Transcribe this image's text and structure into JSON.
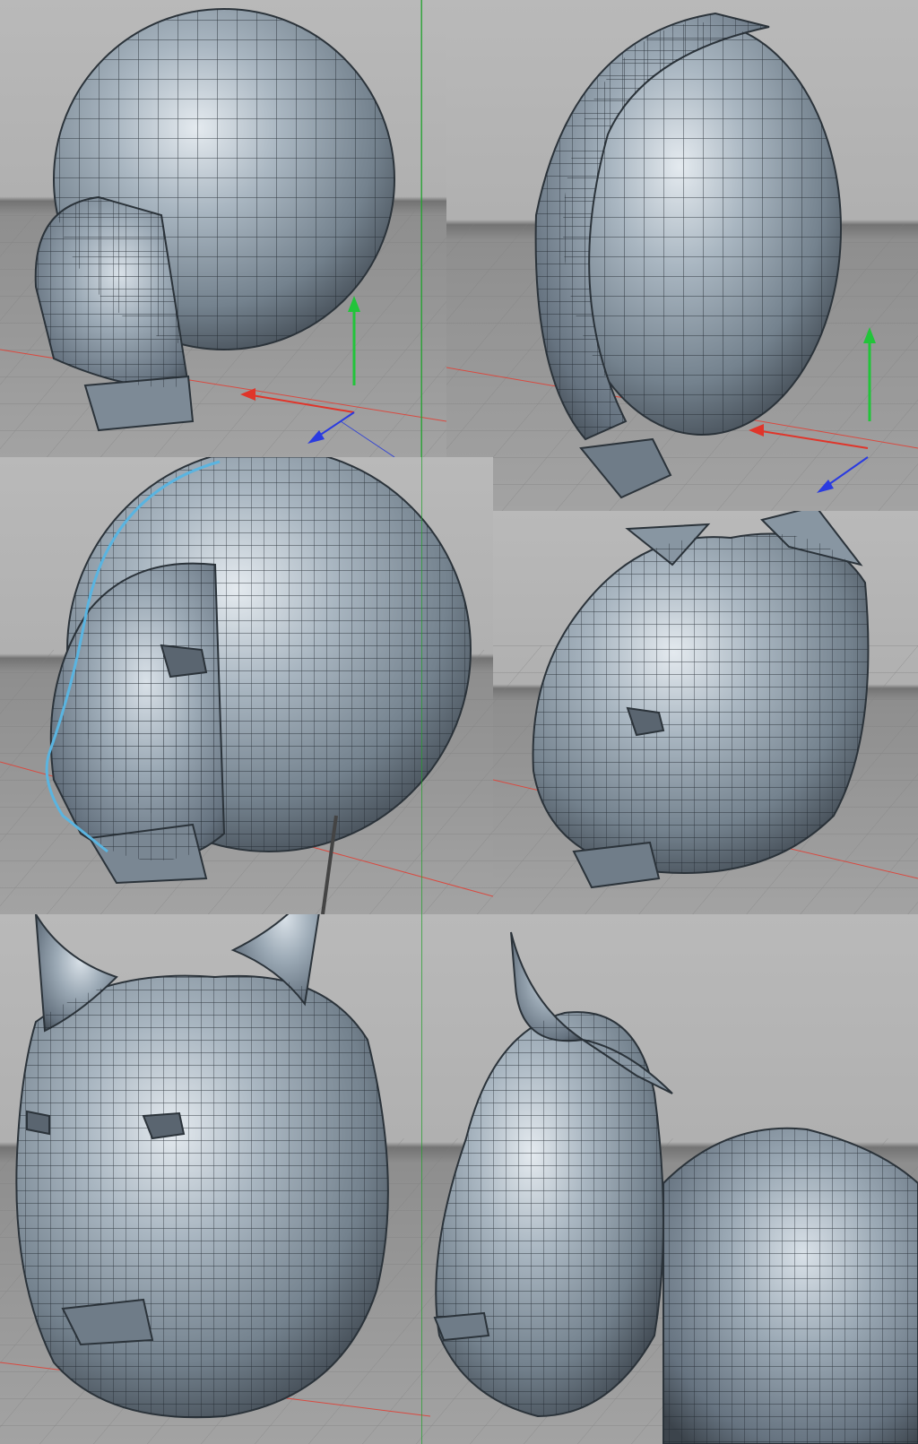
{
  "title": "",
  "colors": {
    "background": "#b2b2b2",
    "horizon": "#6f6f6f",
    "floor": "#9c9c9c",
    "mesh_fill": "#8c9ba8",
    "mesh_light": "#dfe6ec",
    "mesh_dark": "#3e4750",
    "wire": "#222a31",
    "selection_wire": "#5ab4e0",
    "axis_x": "#e0352a",
    "axis_y": "#22c43a",
    "axis_z": "#2a3be0",
    "separator": "#1fa02a"
  },
  "panels": [
    {
      "id": "stage-1",
      "subject": "sphere-head-block-snout",
      "gizmo": true
    },
    {
      "id": "stage-2",
      "subject": "sphere-head-side-plane",
      "gizmo": true
    },
    {
      "id": "stage-3",
      "subject": "head-eye-sockets-selected-edge",
      "gizmo": false
    },
    {
      "id": "stage-4",
      "subject": "head-with-ear-blocks",
      "gizmo": false
    },
    {
      "id": "stage-5",
      "subject": "lynx-head-front-ears",
      "gizmo": false
    },
    {
      "id": "stage-6",
      "subject": "lynx-head-side-body",
      "gizmo": false
    }
  ]
}
